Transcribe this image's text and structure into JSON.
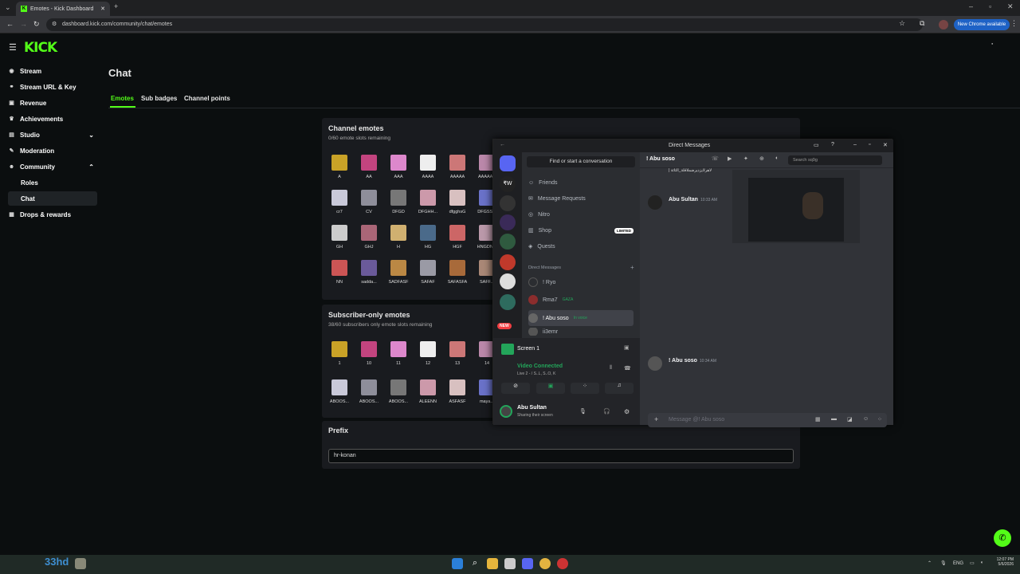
{
  "browser": {
    "tab_title": "Emotes - Kick Dashboard",
    "url": "dashboard.kick.com/community/chat/emotes",
    "new_chrome": "New Chrome available"
  },
  "kick": {
    "brand": "KICK",
    "nav": [
      {
        "label": "Stream",
        "icon": "broadcast-icon"
      },
      {
        "label": "Stream URL & Key",
        "icon": "link-icon"
      },
      {
        "label": "Revenue",
        "icon": "revenue-icon"
      },
      {
        "label": "Achievements",
        "icon": "trophy-icon"
      },
      {
        "label": "Studio",
        "icon": "studio-icon"
      },
      {
        "label": "Moderation",
        "icon": "wrench-icon"
      },
      {
        "label": "Community",
        "icon": "people-icon"
      },
      {
        "label": "Roles",
        "icon": ""
      },
      {
        "label": "Chat",
        "icon": ""
      },
      {
        "label": "Drops & rewards",
        "icon": "gift-icon"
      }
    ],
    "page_title": "Chat",
    "tabs": [
      "Emotes",
      "Sub badges",
      "Channel points"
    ],
    "channel_emotes": {
      "title": "Channel emotes",
      "subtitle": "0/60 emote slots remaining",
      "items": [
        "A",
        "AA",
        "AAA",
        "AAAA",
        "AAAAA",
        "AAAAAA",
        "cr7",
        "CV",
        "DFGD",
        "DFGHH...",
        "dfgghsG",
        "DFGSS...",
        "GH",
        "GHJ",
        "H",
        "HG",
        "HGF",
        "HNGDN...",
        "NN",
        "sadda...",
        "SADFASF",
        "SAFAF",
        "SAFASFA",
        "SAFF..."
      ]
    },
    "subscriber_emotes": {
      "title": "Subscriber-only emotes",
      "subtitle": "38/60 subscribers only emote slots remaining",
      "items": [
        "1",
        "10",
        "11",
        "12",
        "13",
        "14",
        "ABOOS...",
        "ABOOS...",
        "ABOOS...",
        "ALEENN",
        "ASFASF",
        "maya..."
      ]
    },
    "prefix": {
      "title": "Prefix",
      "value": "hr-konan"
    }
  },
  "discord": {
    "window_title": "Direct Messages",
    "search_conv": "Find or start a conversation",
    "menu": [
      {
        "label": "Friends",
        "icon": "friends-icon"
      },
      {
        "label": "Message Requests",
        "icon": "mail-icon"
      },
      {
        "label": "Nitro",
        "icon": "nitro-icon"
      },
      {
        "label": "Shop",
        "icon": "shop-icon",
        "badge": "LIMITED"
      },
      {
        "label": "Quests",
        "icon": "quests-icon"
      }
    ],
    "dm_header": "Direct Messages",
    "dms": [
      {
        "name": "! Ryo",
        "sub": ""
      },
      {
        "name": "Rma7",
        "sub": "GAZA"
      },
      {
        "name": "! Abu soso",
        "sub": "In voice"
      },
      {
        "name": "ii3emr",
        "sub": ""
      }
    ],
    "new_badge": "NEW",
    "screen_label": "Screen 1",
    "video_connected": "Video Connected",
    "video_sub": "Live 2 - / S..L, S..O, K",
    "user_name": "Abu Sultan",
    "user_status": "Sharing their screen",
    "chat_header": "! Abu soso",
    "search_placeholder": "Search sq9g",
    "top_msg": "| لاهرلايزديرضملاقلة_الثاثة",
    "messages": [
      {
        "name": "Abu Sultan",
        "time": "10:33 AM"
      },
      {
        "name": "! Abu soso",
        "time": "10:34 AM"
      }
    ],
    "composer_placeholder": "Message @! Abu soso"
  },
  "taskbar": {
    "weather": "33hd",
    "lang": "ENG",
    "time": "12:07 PM",
    "date": "5/6/2026"
  },
  "colors": {
    "kick_green": "#53fc18",
    "discord_blurple": "#5865f2"
  }
}
